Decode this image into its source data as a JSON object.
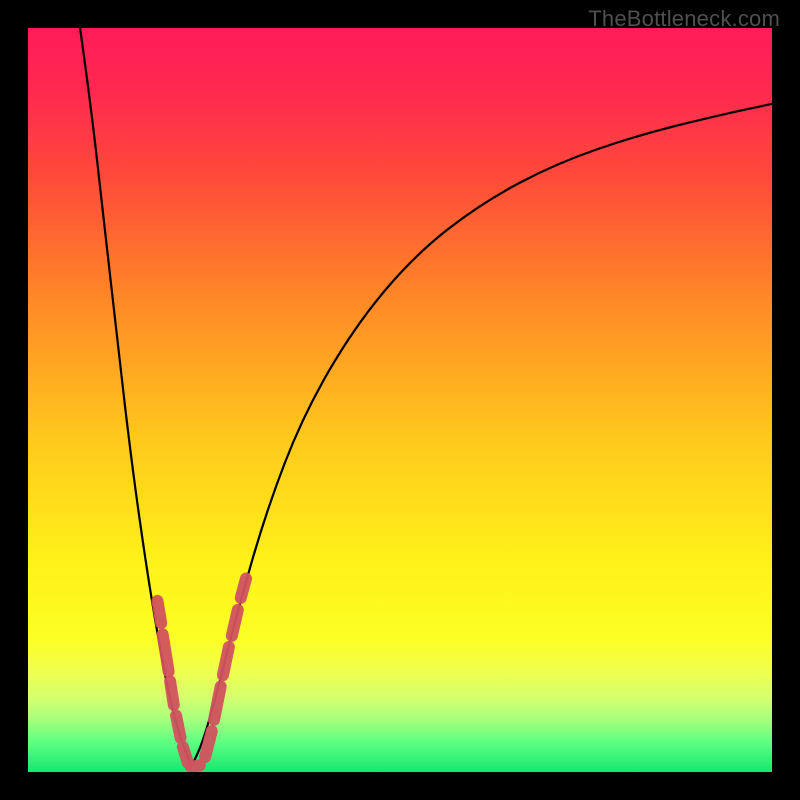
{
  "watermark": "TheBottleneck.com",
  "gradient": {
    "stops": [
      {
        "offset": 0.0,
        "color": "#ff1b58"
      },
      {
        "offset": 0.08,
        "color": "#ff2850"
      },
      {
        "offset": 0.2,
        "color": "#ff4a3a"
      },
      {
        "offset": 0.35,
        "color": "#ff8328"
      },
      {
        "offset": 0.55,
        "color": "#ffc81c"
      },
      {
        "offset": 0.72,
        "color": "#fff21a"
      },
      {
        "offset": 0.82,
        "color": "#fcff24"
      },
      {
        "offset": 0.86,
        "color": "#f2ff4a"
      },
      {
        "offset": 0.9,
        "color": "#d6ff6e"
      },
      {
        "offset": 0.93,
        "color": "#a6ff7e"
      },
      {
        "offset": 0.96,
        "color": "#5dff82"
      },
      {
        "offset": 1.0,
        "color": "#17e86f"
      }
    ]
  },
  "curve_style": {
    "stroke": "#000000",
    "stroke_width": 2.2
  },
  "marker_style": {
    "stroke": "#d1535f",
    "stroke_width": 12,
    "linecap": "round",
    "opacity": 0.95
  },
  "chart_data": {
    "type": "line",
    "title": "",
    "xlabel": "",
    "ylabel": "",
    "xlim": [
      0,
      100
    ],
    "ylim": [
      0,
      100
    ],
    "note": "Axes are unlabeled in the original image; x and y positions are normalized 0–100 from the plotting area (y measured from bottom). Curve values are visually estimated.",
    "series": [
      {
        "name": "left-branch",
        "x": [
          7.0,
          8.5,
          10.0,
          12.0,
          14.0,
          16.0,
          17.5,
          19.0,
          20.5,
          22.0
        ],
        "y": [
          100.0,
          89.0,
          76.0,
          58.0,
          41.0,
          27.0,
          18.0,
          10.0,
          4.5,
          0.8
        ]
      },
      {
        "name": "right-branch",
        "x": [
          22.0,
          23.5,
          25.5,
          28.0,
          32.0,
          37.0,
          44.0,
          52.0,
          61.0,
          71.0,
          82.0,
          93.0,
          100.0
        ],
        "y": [
          0.8,
          4.0,
          11.0,
          21.0,
          35.0,
          48.0,
          60.0,
          69.5,
          76.5,
          81.8,
          85.6,
          88.3,
          89.8
        ]
      }
    ],
    "markers": [
      {
        "name": "left-cluster",
        "segments": [
          {
            "x1": 17.4,
            "y1": 23.0,
            "x2": 17.9,
            "y2": 20.0
          },
          {
            "x1": 18.1,
            "y1": 18.5,
            "x2": 18.9,
            "y2": 13.5
          },
          {
            "x1": 19.1,
            "y1": 12.2,
            "x2": 19.6,
            "y2": 9.0
          },
          {
            "x1": 19.9,
            "y1": 7.6,
            "x2": 20.5,
            "y2": 4.6
          },
          {
            "x1": 20.8,
            "y1": 3.4,
            "x2": 21.5,
            "y2": 1.2
          },
          {
            "x1": 21.9,
            "y1": 0.7,
            "x2": 23.1,
            "y2": 0.9
          }
        ]
      },
      {
        "name": "right-cluster",
        "segments": [
          {
            "x1": 23.8,
            "y1": 2.0,
            "x2": 24.7,
            "y2": 5.5
          },
          {
            "x1": 25.0,
            "y1": 7.0,
            "x2": 25.9,
            "y2": 11.5
          },
          {
            "x1": 26.2,
            "y1": 13.0,
            "x2": 27.0,
            "y2": 16.8
          },
          {
            "x1": 27.4,
            "y1": 18.3,
            "x2": 28.2,
            "y2": 21.8
          },
          {
            "x1": 28.6,
            "y1": 23.4,
            "x2": 29.3,
            "y2": 26.0
          }
        ]
      }
    ]
  }
}
